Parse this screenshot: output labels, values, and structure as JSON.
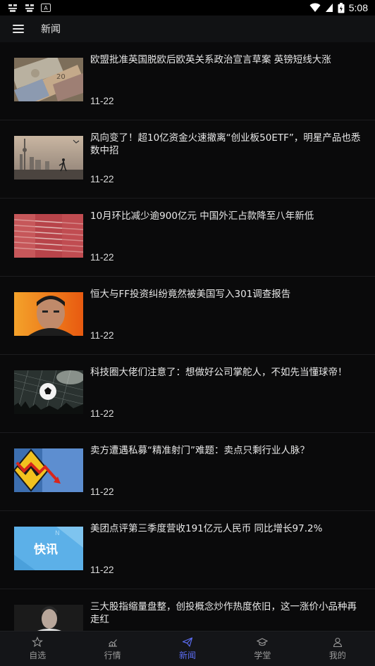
{
  "status": {
    "time": "5:08"
  },
  "app_bar": {
    "title": "新闻"
  },
  "news": [
    {
      "title": "欧盟批准英国脱欧后欧英关系政治宣言草案 英镑短线大涨",
      "date": "11-22",
      "thumb": "money-thumbnail"
    },
    {
      "title": "风向变了！超10亿资金火速撤离“创业板50ETF”，明星产品也悉数中招",
      "date": "11-22",
      "thumb": "city-skyline-thumbnail"
    },
    {
      "title": "10月环比减少逾900亿元 中国外汇占款降至八年新低",
      "date": "11-22",
      "thumb": "rmb-notes-thumbnail"
    },
    {
      "title": "恒大与FF投资纠纷竟然被美国写入301调查报告",
      "date": "11-22",
      "thumb": "portrait-thumbnail"
    },
    {
      "title": "科技圈大佬们注意了：想做好公司掌舵人，不如先当懂球帝！",
      "date": "11-22",
      "thumb": "soccer-ball-thumbnail"
    },
    {
      "title": "卖方遭遇私募“精准射门”难题：卖点只剩行业人脉？",
      "date": "11-22",
      "thumb": "downtrend-sign-thumbnail"
    },
    {
      "title": "美团点评第三季度营收191亿元人民币 同比增长97.2%",
      "date": "11-22",
      "thumb": "flash-news-thumbnail",
      "thumb_text": "快讯"
    },
    {
      "title": "三大股指缩量盘整，创投概念炒作热度依旧，这一涨价小品种再走红",
      "date": "",
      "thumb": "person-thumbnail"
    }
  ],
  "tabs": [
    {
      "label": "自选",
      "icon": "star-icon",
      "active": false
    },
    {
      "label": "行情",
      "icon": "chart-icon",
      "active": false
    },
    {
      "label": "新闻",
      "icon": "paper-plane-icon",
      "active": true
    },
    {
      "label": "学堂",
      "icon": "graduation-cap-icon",
      "active": false
    },
    {
      "label": "我的",
      "icon": "user-icon",
      "active": false
    }
  ],
  "colors": {
    "accent": "#5b6cf0",
    "background": "#0a0a0b",
    "tab_inactive": "#9a9a9a"
  }
}
